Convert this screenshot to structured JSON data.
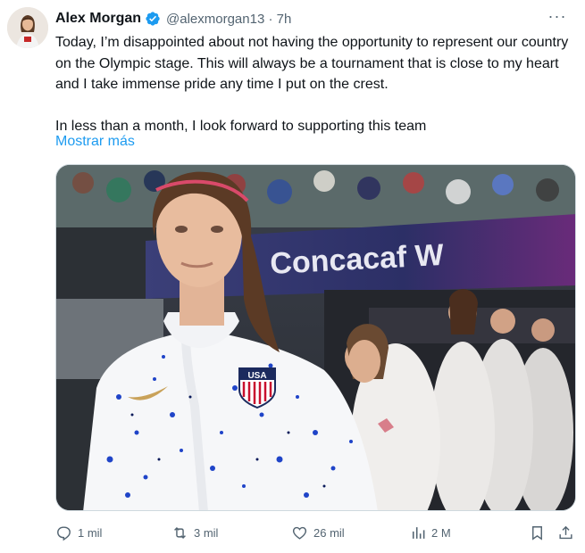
{
  "tweet": {
    "author": {
      "name": "Alex Morgan",
      "handle": "@alexmorgan13",
      "separator": "·",
      "time": "7h",
      "verified_icon": "verified-badge-icon"
    },
    "text": "Today, I’m disappointed about not having the opportunity to represent our country on the Olympic stage. This will always be a tournament that is close to my heart and I take immense pride any time I put on the crest.\n\nIn less than a month, I look forward to supporting this team",
    "show_more": "Mostrar más",
    "media": {
      "banner_text": "Concacaf W",
      "crest_text": "USA"
    },
    "actions": {
      "replies": "1 mil",
      "retweets": "3 mil",
      "likes": "26 mil",
      "views": "2 M"
    }
  },
  "colors": {
    "link": "#1d9bf0",
    "secondary": "#536471",
    "verified": "#1d9bf0"
  }
}
